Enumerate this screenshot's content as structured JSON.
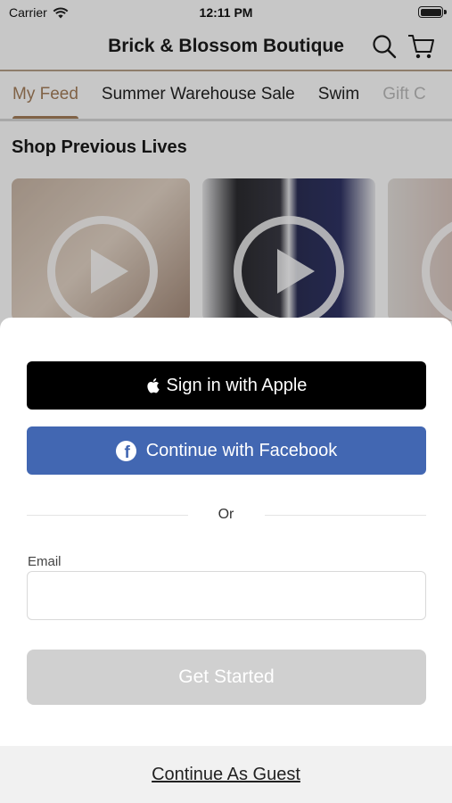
{
  "status_bar": {
    "carrier": "Carrier",
    "time": "12:11 PM"
  },
  "header": {
    "title": "Brick & Blossom Boutique",
    "icons": [
      "search-icon",
      "cart-icon"
    ]
  },
  "tabs": [
    {
      "label": "My Feed",
      "active": true
    },
    {
      "label": "Summer Warehouse Sale",
      "active": false
    },
    {
      "label": "Swim",
      "active": false
    },
    {
      "label": "Gift C",
      "active": false
    }
  ],
  "feed": {
    "section_title": "Shop Previous Lives"
  },
  "login_sheet": {
    "apple_label": "Sign in with Apple",
    "facebook_label": "Continue with Facebook",
    "divider_text": "Or",
    "email_label": "Email",
    "email_value": "",
    "get_started_label": "Get Started",
    "guest_label": "Continue As Guest"
  },
  "colors": {
    "accent": "#a47e5a",
    "facebook": "#4267b2",
    "apple": "#000000",
    "disabled_button": "#d0d0d0"
  }
}
